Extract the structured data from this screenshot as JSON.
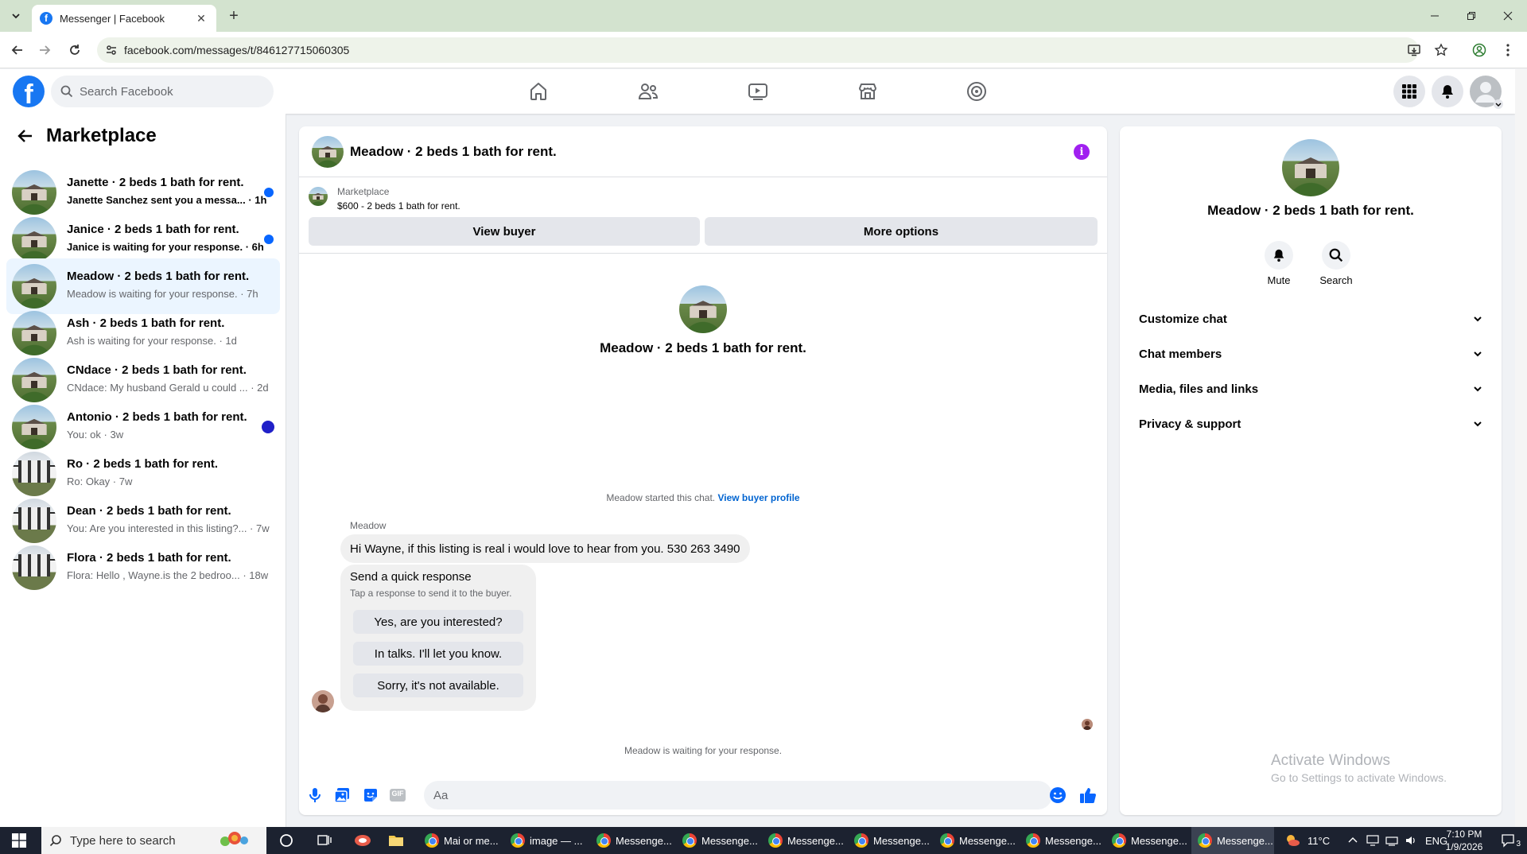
{
  "browser": {
    "tab_title": "Messenger | Facebook",
    "favicon_letter": "f",
    "close_glyph": "✕",
    "newtab_glyph": "+",
    "url": "facebook.com/messages/t/846127715060305"
  },
  "fb": {
    "logo_letter": "f",
    "search_placeholder": "Search Facebook",
    "brand_color": "#1877f2"
  },
  "sidebar": {
    "title": "Marketplace",
    "conversations": [
      {
        "name": "Janette · 2 beds 1 bath for rent.",
        "preview": "Janette Sanchez sent you a messa...",
        "time": " · 1h",
        "unread": true
      },
      {
        "name": "Janice · 2 beds 1 bath for rent.",
        "preview": "Janice is waiting for your response.",
        "time": " · 6h",
        "unread": true
      },
      {
        "name": "Meadow · 2 beds 1 bath for rent.",
        "preview": "Meadow is waiting for your response.",
        "time": " · 7h",
        "active": true
      },
      {
        "name": "Ash · 2 beds 1 bath for rent.",
        "preview": "Ash is waiting for your response.",
        "time": " · 1d"
      },
      {
        "name": "CNdace · 2 beds 1 bath for rent.",
        "preview": "CNdace: My husband Gerald u could ...",
        "time": " · 2d"
      },
      {
        "name": "Antonio · 2 beds 1 bath for rent.",
        "preview": "You: ok",
        "time": " · 3w"
      },
      {
        "name": "Ro · 2 beds 1 bath for rent.",
        "preview": "Ro: Okay",
        "time": " · 7w"
      },
      {
        "name": "Dean · 2 beds 1 bath for rent.",
        "preview": "You: Are you interested in this listing?...",
        "time": " · 7w"
      },
      {
        "name": "Flora · 2 beds 1 bath for rent.",
        "preview": "Flora: Hello , Wayne.is the 2 bedroo...",
        "time": " · 18w"
      }
    ]
  },
  "chat": {
    "title": "Meadow · 2 beds 1 bath for rent.",
    "info_glyph": "i",
    "banner": {
      "label": "Marketplace",
      "listing": "$600 - 2 beds 1 bath for rent.",
      "view_buyer": "View buyer",
      "more_options": "More options"
    },
    "center_title": "Meadow · 2 beds 1 bath for rent.",
    "started_text": "Meadow started this chat. ",
    "started_link": "View buyer profile",
    "sender": "Meadow",
    "message": "Hi Wayne, if this listing is real i would love to hear from you. 530 263 3490",
    "quick": {
      "title": "Send a quick response",
      "subtitle": "Tap a response to send it to the buyer.",
      "options": [
        "Yes, are you interested?",
        "In talks. I'll let you know.",
        "Sorry, it's not available."
      ]
    },
    "waiting": "Meadow is waiting for your response.",
    "composer_placeholder": "Aa",
    "gif_label": "GIF"
  },
  "panel": {
    "title": "Meadow · 2 beds 1 bath for rent.",
    "mute": "Mute",
    "search": "Search",
    "rows": [
      "Customize chat",
      "Chat members",
      "Media, files and links",
      "Privacy & support"
    ]
  },
  "watermark": {
    "line1": "Activate Windows",
    "line2": "Go to Settings to activate Windows."
  },
  "taskbar": {
    "search": "Type here to search",
    "apps": [
      "Mai or me...",
      "image — ...",
      "Messenge...",
      "Messenge...",
      "Messenge...",
      "Messenge...",
      "Messenge...",
      "Messenge...",
      "Messenge...",
      "Messenge..."
    ],
    "weather": "11°C",
    "lang": "ENG",
    "time": "7:10 PM",
    "date": "1/9/2026",
    "notif_count": "3"
  }
}
